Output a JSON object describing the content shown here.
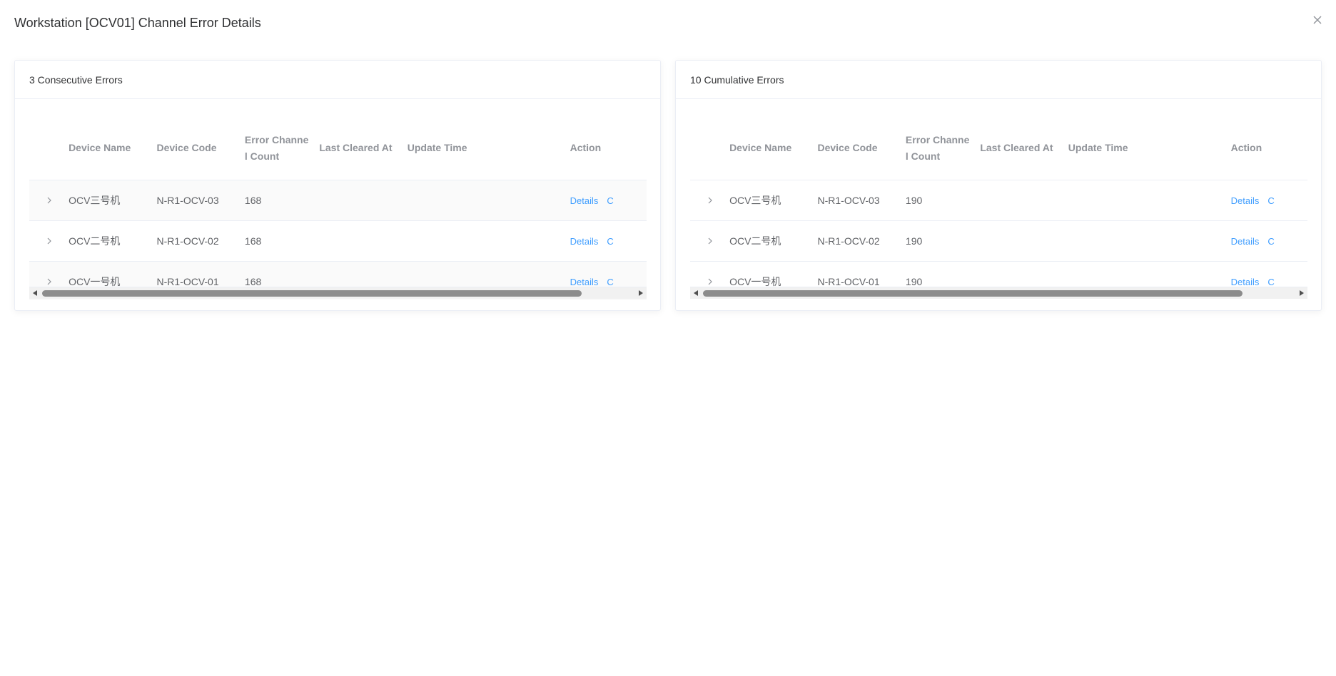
{
  "dialog": {
    "title": "Workstation [OCV01] Channel Error Details"
  },
  "columns": {
    "device_name": "Device Name",
    "device_code": "Device Code",
    "error_count_line1": "Error Channe",
    "error_count_line2": "l Count",
    "last_cleared": "Last Cleared At",
    "update_time": "Update Time",
    "action": "Action"
  },
  "panels": [
    {
      "title": "3 Consecutive Errors",
      "rows": [
        {
          "name": "OCV三号机",
          "code": "N-R1-OCV-03",
          "count": "168",
          "last_cleared": "",
          "update_time": "",
          "details": "Details",
          "other": "C"
        },
        {
          "name": "OCV二号机",
          "code": "N-R1-OCV-02",
          "count": "168",
          "last_cleared": "",
          "update_time": "",
          "details": "Details",
          "other": "C"
        },
        {
          "name": "OCV一号机",
          "code": "N-R1-OCV-01",
          "count": "168",
          "last_cleared": "",
          "update_time": "",
          "details": "Details",
          "other": "C"
        }
      ]
    },
    {
      "title": "10 Cumulative Errors",
      "rows": [
        {
          "name": "OCV三号机",
          "code": "N-R1-OCV-03",
          "count": "190",
          "last_cleared": "",
          "update_time": "",
          "details": "Details",
          "other": "C"
        },
        {
          "name": "OCV二号机",
          "code": "N-R1-OCV-02",
          "count": "190",
          "last_cleared": "",
          "update_time": "",
          "details": "Details",
          "other": "C"
        },
        {
          "name": "OCV一号机",
          "code": "N-R1-OCV-01",
          "count": "190",
          "last_cleared": "",
          "update_time": "",
          "details": "Details",
          "other": "C"
        }
      ]
    }
  ],
  "icons": {
    "close": "close-icon",
    "expand": "chevron-right-icon",
    "scroll_left": "scroll-left-arrow-icon",
    "scroll_right": "scroll-right-arrow-icon"
  },
  "colors": {
    "link": "#409eff",
    "header_text": "#909399",
    "cell_text": "#606266",
    "border": "#ebeef5"
  }
}
